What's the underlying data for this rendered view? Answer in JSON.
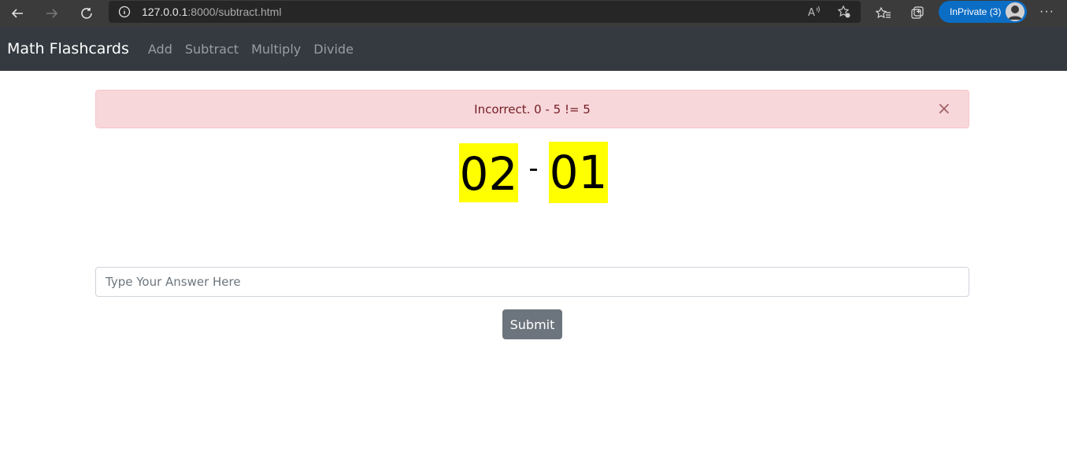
{
  "browser": {
    "url_host": "127.0.0.1",
    "url_path": ":8000/subtract.html",
    "inprivate_label": "InPrivate (3)",
    "more_label": "···"
  },
  "navbar": {
    "brand": "Math Flashcards",
    "links": [
      "Add",
      "Subtract",
      "Multiply",
      "Divide"
    ]
  },
  "alert": {
    "message": "Incorrect. 0 - 5 != 5",
    "close_symbol": "×"
  },
  "problem": {
    "first": "02",
    "operator": "-",
    "second": "01",
    "highlight_color": "#ffff00"
  },
  "answer_input": {
    "placeholder": "Type Your Answer Here",
    "value": ""
  },
  "submit_label": "Submit"
}
